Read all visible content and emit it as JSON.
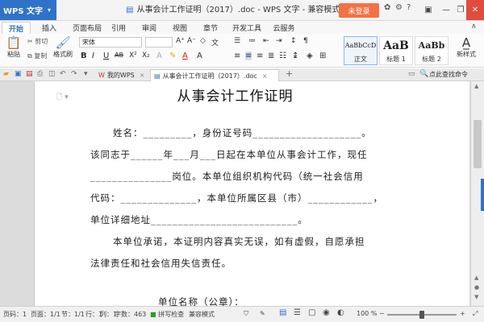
{
  "titlebar": {
    "app_name": "WPS 文字",
    "app_dropdown": "▾",
    "doc_title": "从事会计工作证明（2017）.doc - WPS 文字 - 兼容模式",
    "login_label": "未登录",
    "icons": [
      "skin-icon",
      "settings-icon",
      "help-icon",
      "minimize-icon",
      "restore-icon",
      "close-icon"
    ]
  },
  "tabs": [
    "开始",
    "插入",
    "页面布局",
    "引用",
    "审阅",
    "视图",
    "章节",
    "开发工具",
    "云服务"
  ],
  "ribbon": {
    "paste_label": "粘贴",
    "cut_label": "剪切",
    "copy_label": "复制",
    "format_painter_label": "格式刷",
    "font_name": "宋体",
    "styles": [
      {
        "sample": "AaBbCcD",
        "label": "正文"
      },
      {
        "sample": "AaB",
        "label": "标题 1"
      },
      {
        "sample": "AaBb",
        "label": "标题 2"
      }
    ],
    "new_style_label": "新样式"
  },
  "doctabs": {
    "tab1_label": "我的WPS",
    "tab2_label": "从事会计工作证明（2017）.doc",
    "add_label": "+",
    "find_label": "点此查找命令"
  },
  "document": {
    "heading": "从事会计工作证明",
    "lines": [
      "姓名：_________，身份证号码____________________。",
      "该同志于______年___月___日起在本单位从事会计工作，现任",
      "_______________岗位。本单位组织机构代码（统一社会信用",
      "代码：______________，本单位所属区县（市）____________，",
      "单位详细地址___________________________。",
      "本单位承诺，本证明内容真实无误，如有虚假，自愿承担",
      "法律责任和社会信用失信责任。",
      "单位名称（公章）："
    ]
  },
  "statusbar": {
    "page_num": "页码：1",
    "pages": "页面：1/1",
    "section": "节：1/1",
    "row": "行：1",
    "col": "列：1",
    "words": "字数：463",
    "spell": "拼写检查",
    "mode": "兼容模式",
    "zoom": "100 %"
  }
}
